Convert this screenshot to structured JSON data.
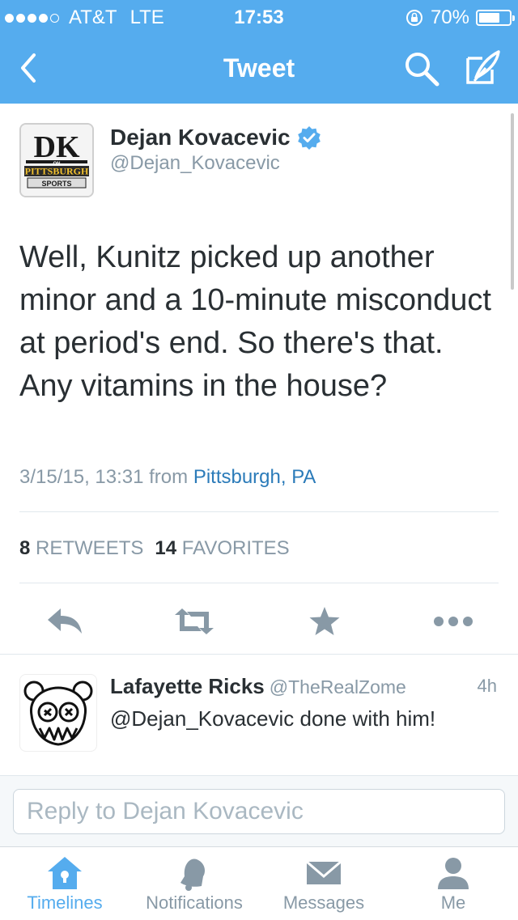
{
  "status_bar": {
    "carrier": "AT&T",
    "network": "LTE",
    "time": "17:53",
    "battery": "70%",
    "battery_level": 0.7
  },
  "nav": {
    "title": "Tweet"
  },
  "tweet": {
    "author_name": "Dejan Kovacevic",
    "author_handle": "@Dejan_Kovacevic",
    "verified": true,
    "text": "Well, Kunitz picked up another minor and a 10-minute misconduct at period's end. So there's that. Any vitamins in the house?",
    "timestamp": "3/15/15, 13:31",
    "from_label": "from",
    "location": "Pittsburgh, PA",
    "retweets_count": "8",
    "retweets_label": "RETWEETS",
    "favorites_count": "14",
    "favorites_label": "FAVORITES"
  },
  "reply": {
    "name": "Lafayette Ricks",
    "handle": "@TheRealZome",
    "time": "4h",
    "text": "@Dejan_Kovacevic done with him!"
  },
  "reply_box": {
    "placeholder": "Reply to Dejan Kovacevic"
  },
  "tabs": [
    {
      "label": "Timelines",
      "icon": "home-icon"
    },
    {
      "label": "Notifications",
      "icon": "bell-icon"
    },
    {
      "label": "Messages",
      "icon": "envelope-icon"
    },
    {
      "label": "Me",
      "icon": "person-icon"
    }
  ],
  "colors": {
    "accent": "#55acee",
    "text": "#292f33",
    "muted": "#8899a6",
    "link": "#2b7bb9",
    "action_icon": "#8899a6"
  }
}
